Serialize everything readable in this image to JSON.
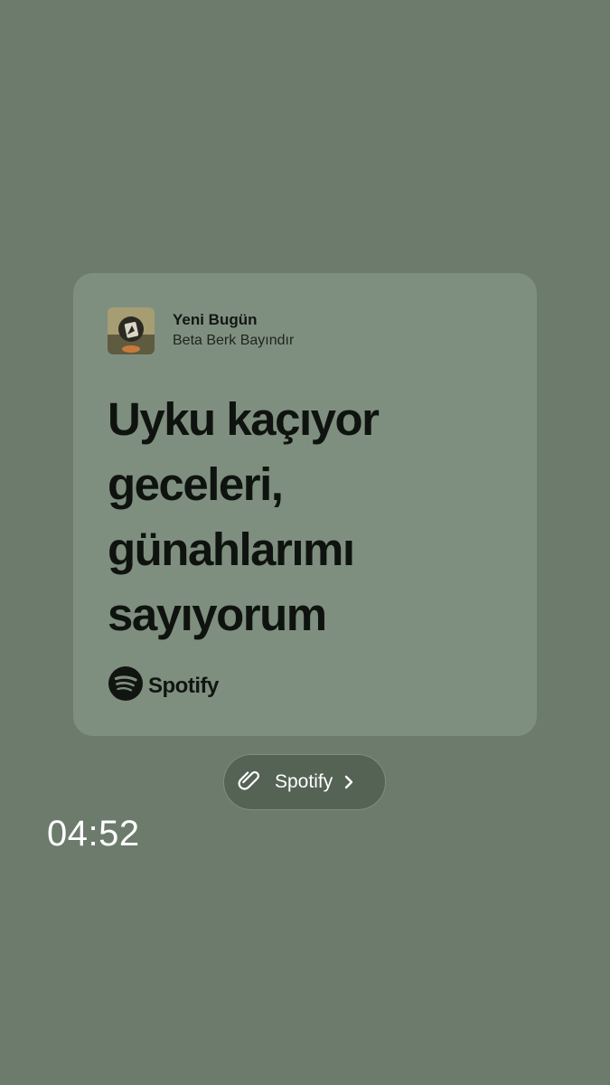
{
  "card": {
    "track_title": "Yeni Bugün",
    "artist": "Beta Berk Bayındır",
    "lyrics": [
      "Uyku kaçıyor",
      "geceleri,",
      "günahlarımı",
      "sayıyorum"
    ],
    "brand": "Spotify",
    "cover_icon": "album-cover"
  },
  "link_sticker": {
    "label": "Spotify",
    "icon": "paperclip-icon",
    "chevron": "chevron-right-icon"
  },
  "timestamp": "04:52",
  "colors": {
    "background": "#6c7b6c",
    "card": "#7f8f7f",
    "pill": "#556355"
  }
}
